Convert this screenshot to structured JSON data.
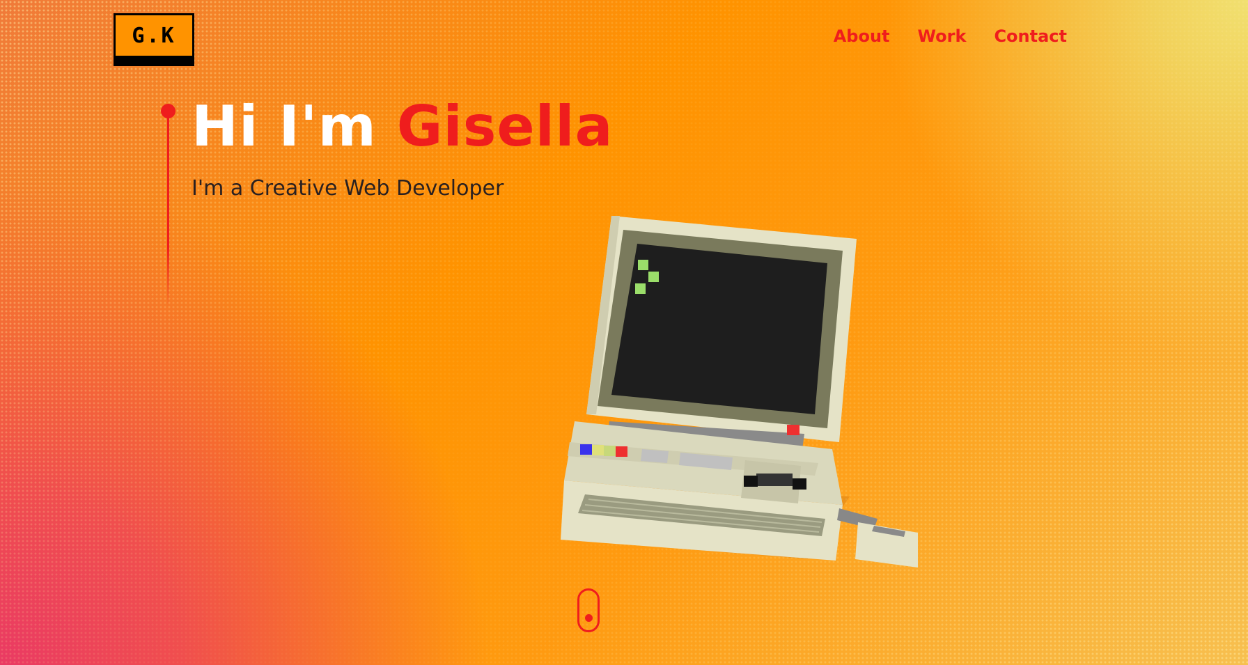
{
  "logo": {
    "text": "G.K"
  },
  "nav": {
    "items": [
      {
        "label": "About"
      },
      {
        "label": "Work"
      },
      {
        "label": "Contact"
      }
    ]
  },
  "hero": {
    "greeting": "Hi I'm",
    "name": "Gisella",
    "subtitle": "I'm a Creative Web Developer"
  },
  "illustration": {
    "icon": "retro-computer-icon"
  },
  "scroll_indicator": {
    "icon": "mouse-scroll-icon"
  },
  "colors": {
    "accent": "#ef1d1d",
    "background": "#ff9300",
    "title": "#ffffff",
    "subtitle": "#2a2020"
  }
}
